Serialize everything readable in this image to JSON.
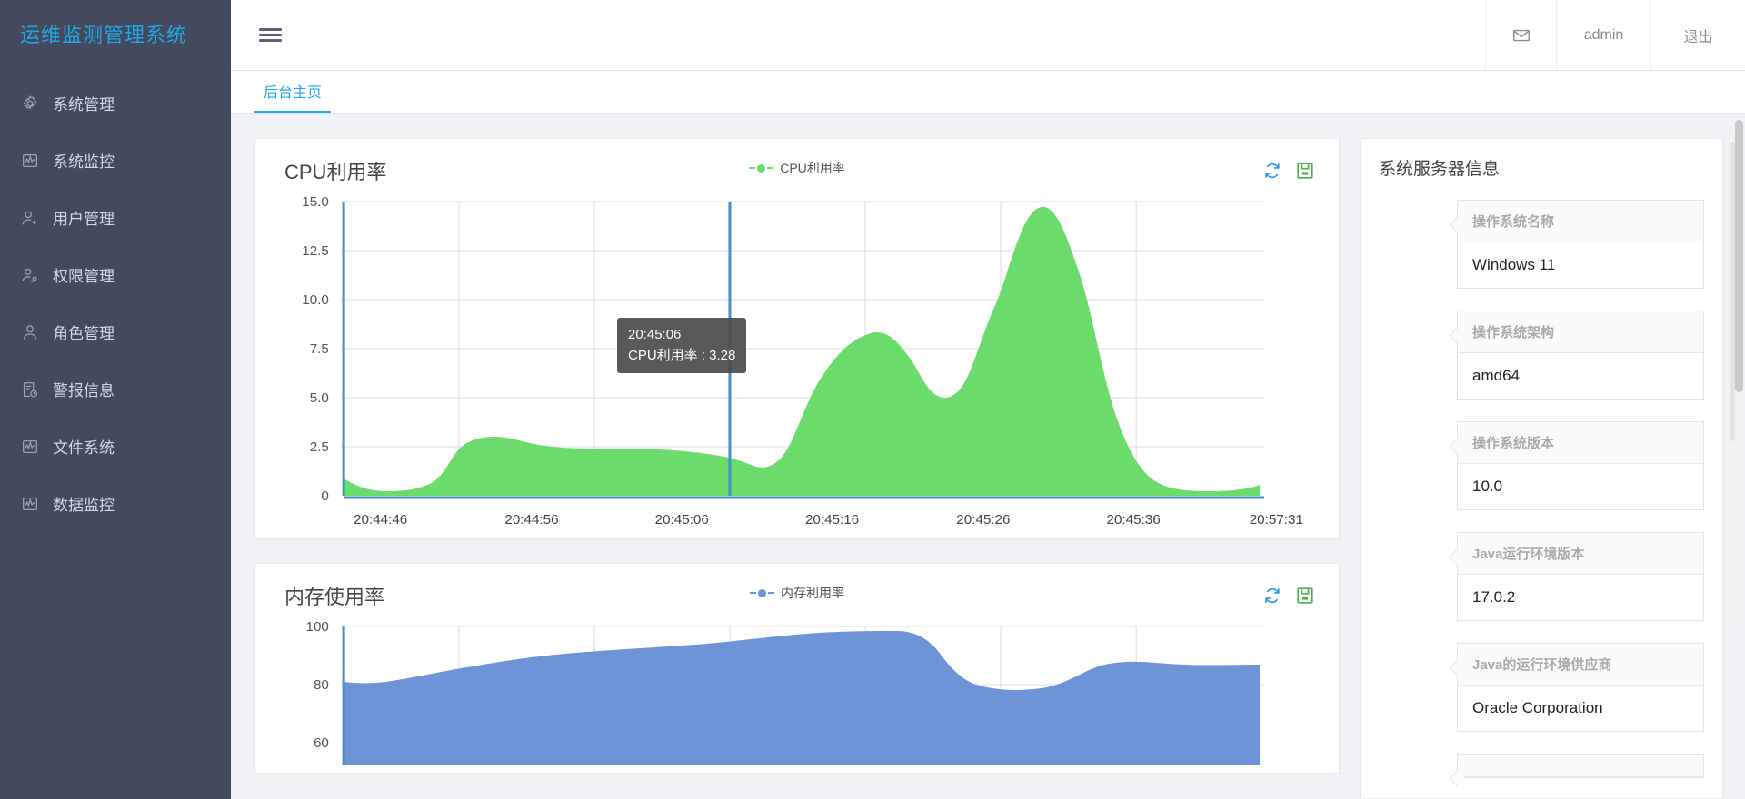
{
  "brand": {
    "title": "运维监测管理系统"
  },
  "sidebar": {
    "items": [
      {
        "label": "系统管理",
        "icon": "gear-icon"
      },
      {
        "label": "系统监控",
        "icon": "monitor-icon"
      },
      {
        "label": "用户管理",
        "icon": "user-add-icon"
      },
      {
        "label": "权限管理",
        "icon": "user-key-icon"
      },
      {
        "label": "角色管理",
        "icon": "user-icon"
      },
      {
        "label": "警报信息",
        "icon": "alert-clock-icon"
      },
      {
        "label": "文件系统",
        "icon": "monitor-icon"
      },
      {
        "label": "数据监控",
        "icon": "monitor-icon"
      }
    ]
  },
  "topbar": {
    "menu_icon": "hamburger-icon",
    "mail_icon": "envelope-icon",
    "user": "admin",
    "logout": "退出"
  },
  "tabs": [
    {
      "label": "后台主页",
      "active": true
    }
  ],
  "cpu_card": {
    "title": "CPU利用率",
    "legend": "CPU利用率",
    "refresh_icon": "refresh-icon",
    "save_icon": "save-icon",
    "tooltip": {
      "time": "20:45:06",
      "text": "CPU利用率 : 3.28"
    }
  },
  "mem_card": {
    "title": "内存使用率",
    "legend": "内存利用率",
    "refresh_icon": "refresh-icon",
    "save_icon": "save-icon"
  },
  "server_info": {
    "title": "系统服务器信息",
    "items": [
      {
        "label": "操作系统名称",
        "value": "Windows 11"
      },
      {
        "label": "操作系统架构",
        "value": "amd64"
      },
      {
        "label": "操作系统版本",
        "value": "10.0"
      },
      {
        "label": "Java运行环境版本",
        "value": "17.0.2"
      },
      {
        "label": "Java的运行环境供应商",
        "value": "Oracle Corporation"
      },
      {
        "label": "",
        "value": ""
      }
    ]
  },
  "colors": {
    "brand": "#1fa7e8",
    "sidebar": "#434a5e",
    "cpu_series": "#6bdc6b",
    "mem_series": "#6e94d8",
    "axis": "#4a90c4"
  },
  "chart_data": [
    {
      "type": "area",
      "title": "CPU利用率",
      "series": [
        {
          "name": "CPU利用率",
          "color": "#6bdc6b",
          "values": [
            0.9,
            0.5,
            0.5,
            1.2,
            2.6,
            3.6,
            3.9,
            3.7,
            3.5,
            3.4,
            3.35,
            3.28,
            2.9,
            2.7,
            3.4,
            6.2,
            8.9,
            10.2,
            11.0,
            10.4,
            8.4,
            6.3,
            5.9,
            7.2,
            10.2,
            13.2,
            14.8,
            13.0,
            9.0,
            5.0,
            2.7,
            1.6,
            1.1,
            0.9
          ]
        }
      ],
      "x": [
        "20:44:46",
        "20:44:56",
        "20:45:06",
        "20:45:16",
        "20:45:26",
        "20:45:36",
        "20:57:31"
      ],
      "xlabel": "",
      "ylabel": "",
      "ylim": [
        0,
        15
      ],
      "yticks": [
        "0",
        "2.5",
        "5.0",
        "7.5",
        "10.0",
        "12.5",
        "15.0"
      ],
      "grid": true,
      "legend_position": "top-center",
      "annotations": [
        {
          "x": "20:45:06",
          "label": "20:45:06",
          "value": 3.28
        }
      ]
    },
    {
      "type": "area",
      "title": "内存使用率",
      "series": [
        {
          "name": "内存利用率",
          "color": "#6e94d8",
          "values": [
            81.0,
            80.6,
            80.5,
            81.5,
            83.2,
            84.5,
            85.4,
            86.3,
            87.2,
            88.0,
            88.6,
            89.4,
            90.6,
            92.0,
            93.4,
            94.6,
            95.4,
            96.0,
            96.1,
            96.0,
            95.0,
            91.0,
            86.0,
            82.0,
            80.0,
            79.4,
            79.2,
            79.6,
            81.5,
            84.0,
            85.6,
            85.4,
            85.2,
            85.2
          ]
        }
      ],
      "x": [],
      "ylim": [
        60,
        100
      ],
      "yticks": [
        "60",
        "80",
        "100"
      ],
      "grid": true,
      "legend_position": "top-center"
    }
  ]
}
